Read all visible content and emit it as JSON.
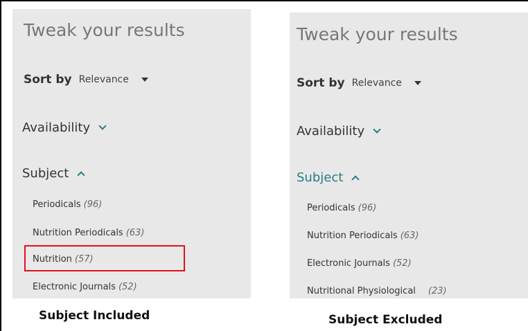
{
  "left_panel": {
    "heading": "Tweak your results",
    "sort_label": "Sort by",
    "sort_value": "Relevance",
    "availability_label": "Availability",
    "subject_label": "Subject",
    "facets": [
      {
        "label": "Periodicals",
        "count": "(96)"
      },
      {
        "label": "Nutrition Periodicals",
        "count": "(63)"
      },
      {
        "label": "Nutrition",
        "count": "(57)"
      },
      {
        "label": "Electronic Journals",
        "count": "(52)"
      }
    ],
    "caption": "Subject Included"
  },
  "right_panel": {
    "heading": "Tweak your results",
    "sort_label": "Sort by",
    "sort_value": "Relevance",
    "availability_label": "Availability",
    "subject_label": "Subject",
    "facets": [
      {
        "label": "Periodicals",
        "count": "(96)"
      },
      {
        "label": "Nutrition Periodicals",
        "count": "(63)"
      },
      {
        "label": "Electronic Journals",
        "count": "(52)"
      },
      {
        "label": "Nutritional Physiological",
        "count": "(23)"
      }
    ],
    "caption": "Subject Excluded"
  },
  "colors": {
    "panel_bg": "#e8e8e8",
    "highlight": "#e0101e",
    "accent": "#2b7b82"
  },
  "icons": [
    "caret-down-icon",
    "chevron-down-icon",
    "chevron-up-icon"
  ]
}
